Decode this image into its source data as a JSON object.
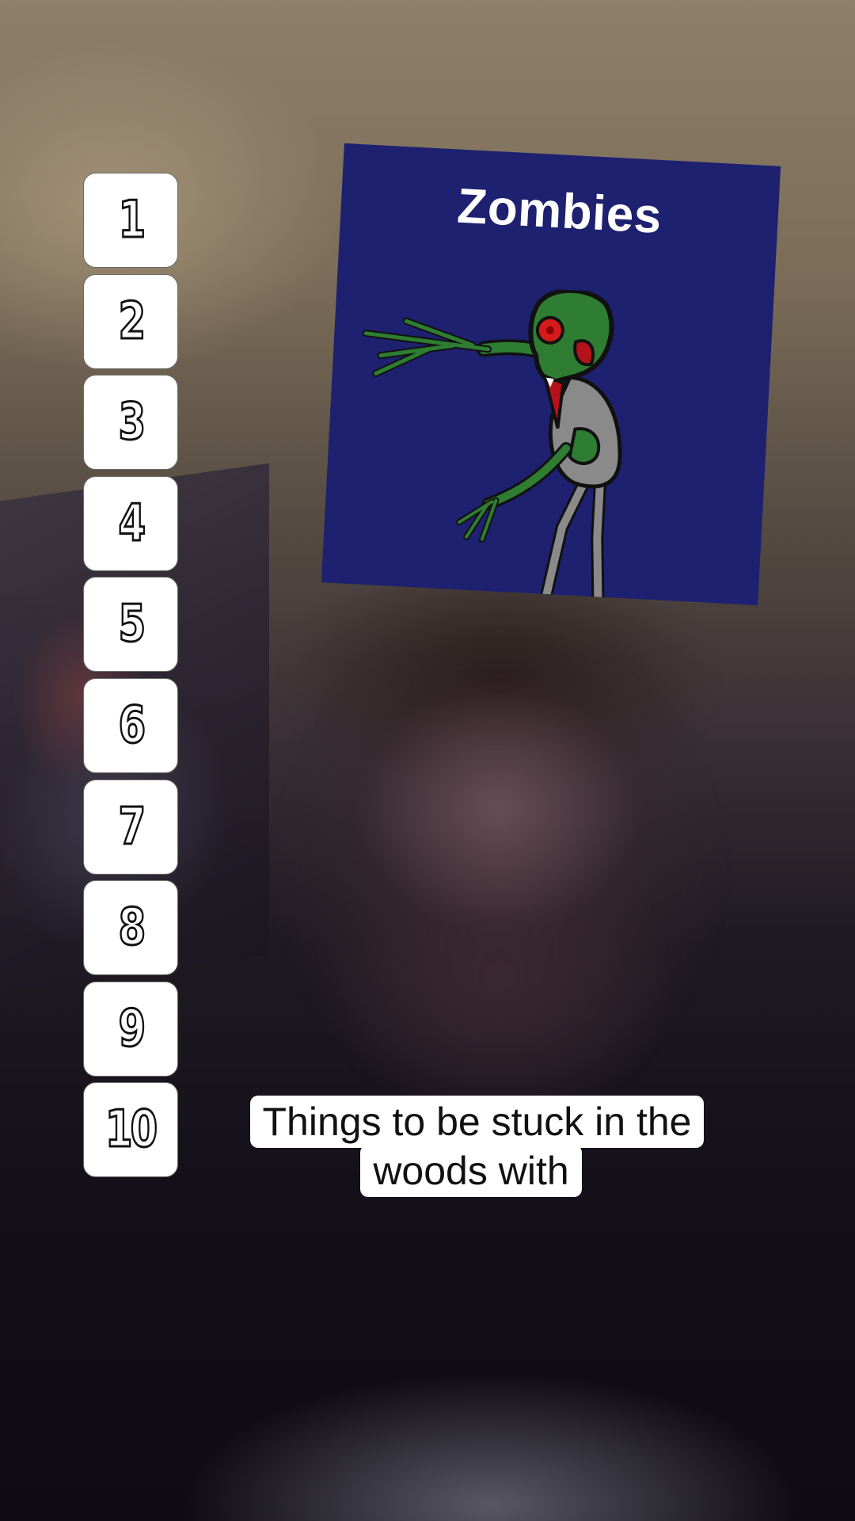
{
  "ranking": {
    "slots": [
      "1",
      "2",
      "3",
      "4",
      "5",
      "6",
      "7",
      "8",
      "9",
      "10"
    ]
  },
  "card": {
    "title": "Zombies",
    "background_color": "#1e2170",
    "image_icon": "zombie-drawing"
  },
  "caption": {
    "line1": "Things to be stuck in the",
    "line2": "woods with"
  }
}
